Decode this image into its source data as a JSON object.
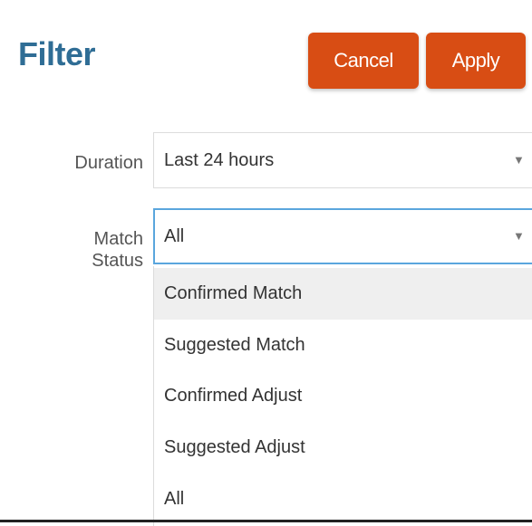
{
  "header": {
    "title": "Filter",
    "cancel_label": "Cancel",
    "apply_label": "Apply"
  },
  "form": {
    "duration": {
      "label": "Duration",
      "value": "Last 24 hours",
      "arrow_icon": "caret-down-icon"
    },
    "match_status": {
      "label_line1": "Match",
      "label_line2": "Status",
      "value": "All",
      "arrow_icon": "caret-down-icon",
      "options": [
        "Confirmed Match",
        "Suggested Match",
        "Confirmed Adjust",
        "Suggested Adjust",
        "All"
      ],
      "highlighted_option": "Confirmed Match"
    }
  },
  "colors": {
    "title": "#2f6d95",
    "button": "#d84d14",
    "focus_border": "#5aa6dd",
    "highlight": "#efefef"
  }
}
